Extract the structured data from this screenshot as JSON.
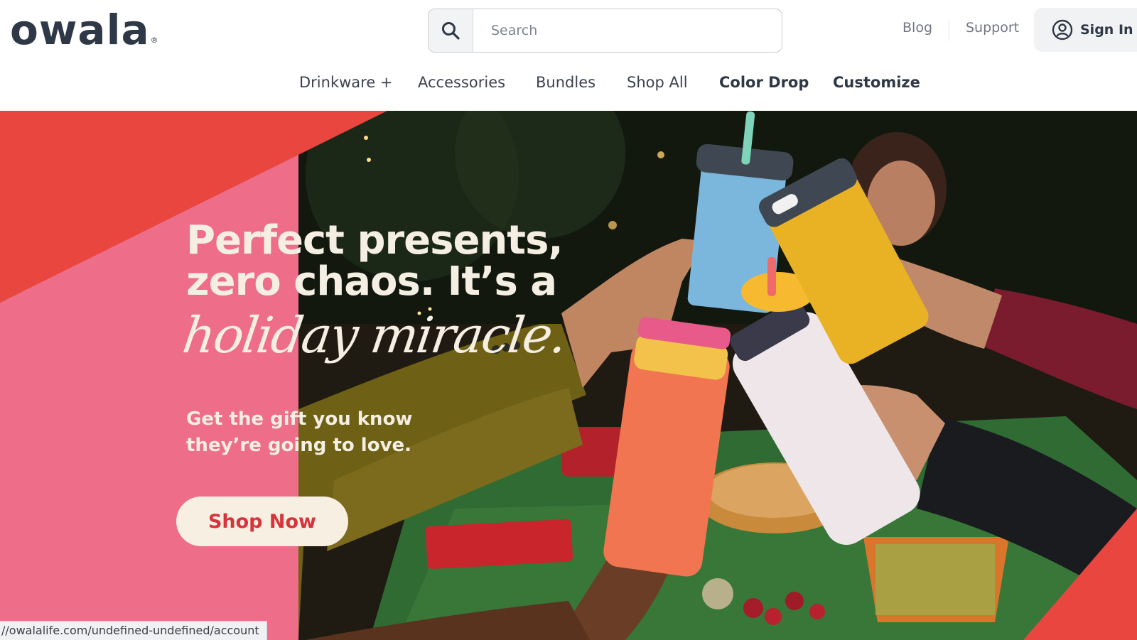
{
  "brand": {
    "logo_text": "owala",
    "logo_mark": "®"
  },
  "search": {
    "placeholder": "Search",
    "icon": "search-icon"
  },
  "top_links": {
    "blog": "Blog",
    "support": "Support"
  },
  "account": {
    "sign_in_label": "Sign In",
    "icon": "user-circle-icon"
  },
  "nav": {
    "items": [
      {
        "label": "Drinkware +",
        "bold": false
      },
      {
        "label": "Accessories",
        "bold": false
      },
      {
        "label": "Bundles",
        "bold": false
      },
      {
        "label": "Shop All",
        "bold": false
      },
      {
        "label": "Color Drop",
        "bold": true
      },
      {
        "label": "Customize",
        "bold": true
      }
    ]
  },
  "hero": {
    "headline_line1": "Perfect presents,",
    "headline_line2": "zero chaos. It’s a",
    "headline_script": "holiday miracle.",
    "subcopy_line1": "Get the gift you know",
    "subcopy_line2": "they’re going to love.",
    "cta_label": "Shop Now",
    "colors": {
      "red": "#e8463f",
      "pink": "#ee6d89",
      "cream": "#f5efe3",
      "cta_text": "#d8323a"
    }
  },
  "status_bar": {
    "url": "//owalalife.com/undefined-undefined/account"
  }
}
